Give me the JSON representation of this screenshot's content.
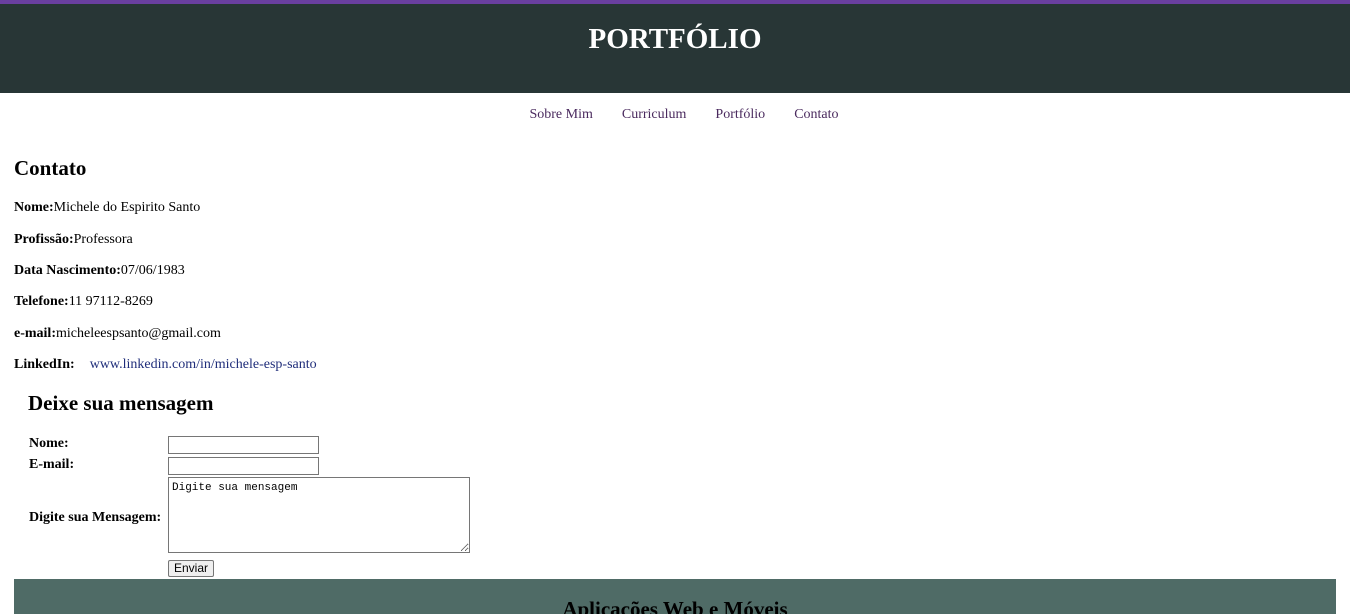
{
  "header": {
    "title": "PORTFÓLIO"
  },
  "nav": {
    "items": [
      "Sobre Mim",
      "Curriculum",
      "Portfólio",
      "Contato"
    ]
  },
  "contato": {
    "title": "Contato",
    "fields": [
      {
        "label": "Nome:",
        "value": "Michele do Espirito Santo"
      },
      {
        "label": "Profissão:",
        "value": "Professora"
      },
      {
        "label": "Data Nascimento:",
        "value": "07/06/1983"
      },
      {
        "label": "Telefone:",
        "value": "11 97112-8269"
      },
      {
        "label": "e-mail:",
        "value": "micheleespsanto@gmail.com"
      }
    ],
    "linkedin": {
      "label": "LinkedIn:",
      "value": "www.linkedin.com/in/michele-esp-santo"
    }
  },
  "form": {
    "title": "Deixe sua mensagem",
    "name_label": "Nome:",
    "name_value": "",
    "email_label": "E-mail:",
    "email_value": "",
    "message_label": "Digite sua Mensagem:",
    "message_placeholder": "Digite sua mensagem",
    "submit_label": "Enviar"
  },
  "footer": {
    "heading": "Aplicações Web e Móveis"
  },
  "colors": {
    "top_line": "#6a3fa0",
    "header_bg": "#283636",
    "nav_link": "#4a2a5e",
    "link": "#1f2d7a",
    "footer_bg": "#4f6b66"
  }
}
